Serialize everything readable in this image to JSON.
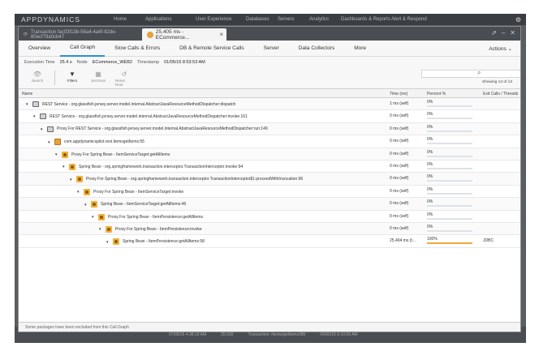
{
  "app": {
    "logo": "APPDYNAMICS",
    "nav": [
      "Home",
      "Applications",
      "User Experience",
      "Databases",
      "Servers",
      "Analytics",
      "Dashboards & Reports",
      "Alert & Respond"
    ],
    "footer": [
      "07/05/16 4:38:19 AM",
      "25,530",
      "Transaction: /items/getItems/98/",
      "06/05/16 6:10:59 AM"
    ]
  },
  "window": {
    "tab_inactive_label": "Transaction fac03f13b-56a4-4a6f-82de-80ecf79a0cb47",
    "tab_active_label": "25,405 ms - ECommerce...",
    "controls": [
      "⇗",
      "–",
      "✕"
    ]
  },
  "menu": {
    "items": [
      "Overview",
      "Call Graph",
      "Slow Calls & Errors",
      "DB & Remote Service Calls",
      "Server",
      "Data Collectors",
      "More"
    ],
    "active_index": 1,
    "actions_label": "Actions"
  },
  "info": {
    "exec_time_label": "Execution Time",
    "exec_time_value": "25.4 s",
    "node_label": "Node",
    "node_value": "ECommerce_WEB2",
    "timestamp_label": "Timestamp",
    "timestamp_value": "01/05/16 8:53:53 AM"
  },
  "toolbar": {
    "buttons": [
      {
        "label": "Search",
        "icon": "eye-icon",
        "enabled": false
      },
      {
        "label": "Filters",
        "icon": "filter-icon",
        "enabled": true
      },
      {
        "label": "Set Root",
        "icon": "set-root-icon",
        "enabled": false
      },
      {
        "label": "Reset Root",
        "icon": "reset-root-icon",
        "enabled": false
      }
    ],
    "search_placeholder": "",
    "showing_text": "Showing 13 of 13"
  },
  "table": {
    "columns": [
      "Name",
      "Time (ms)",
      "Percent %",
      "Exit Calls / Threads"
    ],
    "rows": [
      {
        "icon": "service",
        "depth": 0,
        "name": "REST Service - org.glassfish.jersey.server.model.internal.AbstractJavaResourceMethodDispatcher:dispatch",
        "time": "1 ms (self)",
        "percent": "0%",
        "fraction": 0,
        "exit": ""
      },
      {
        "icon": "service",
        "depth": 1,
        "name": "REST Service - org.glassfish.jersey.server.model.internal.AbstractJavaResourceMethodDispatcher:invoke:161",
        "time": "0 ms (self)",
        "percent": "0%",
        "fraction": 0,
        "exit": ""
      },
      {
        "icon": "service",
        "depth": 2,
        "name": "Proxy For REST Service - org.glassfish.jersey.server.model.internal.AbstractJavaResourceMethodDispatcher:run:149",
        "time": "0 ms (self)",
        "percent": "0%",
        "fraction": 0,
        "exit": ""
      },
      {
        "icon": "package",
        "depth": 3,
        "name": "com.appdynamicspilot.rest.ItemsgetItems:55",
        "time": "0 ms (self)",
        "percent": "0%",
        "fraction": 0,
        "exit": ""
      },
      {
        "icon": "bean",
        "depth": 4,
        "name": "Proxy For Spring Bean - ItemServiceTarget:getAllItems",
        "time": "0 ms (self)",
        "percent": "0%",
        "fraction": 0,
        "exit": ""
      },
      {
        "icon": "bean",
        "depth": 5,
        "name": "Spring Bean - org.springframework.transaction.interceptor.TransactionInterceptor:invoke:94",
        "time": "0 ms (self)",
        "percent": "0%",
        "fraction": 0,
        "exit": ""
      },
      {
        "icon": "bean",
        "depth": 6,
        "name": "Proxy For Spring Bean - org.springframework.transaction.interceptor.TransactionInterceptor$1:proceedWithInvocation:96",
        "time": "0 ms (self)",
        "percent": "0%",
        "fraction": 0,
        "exit": ""
      },
      {
        "icon": "bean",
        "depth": 7,
        "name": "Proxy For Spring Bean - ItemServiceTarget:invoke",
        "time": "0 ms (self)",
        "percent": "0%",
        "fraction": 0,
        "exit": ""
      },
      {
        "icon": "bean",
        "depth": 8,
        "name": "Spring Bean - ItemServiceTarget:getAllItems:46",
        "time": "0 ms (self)",
        "percent": "0%",
        "fraction": 0,
        "exit": ""
      },
      {
        "icon": "bean",
        "depth": 9,
        "name": "Proxy For Spring Bean - ItemPersistence:getAllItems",
        "time": "0 ms (self)",
        "percent": "0%",
        "fraction": 0,
        "exit": ""
      },
      {
        "icon": "bean",
        "depth": 10,
        "name": "Proxy For Spring Bean - ItemPersistence:invoke",
        "time": "0 ms (self)",
        "percent": "0%",
        "fraction": 0,
        "exit": ""
      },
      {
        "icon": "bean",
        "depth": 11,
        "name": "Spring Bean - ItemPersistence:getAllItems:58",
        "time": "25,404 ms (t...",
        "percent": "100%",
        "fraction": 1,
        "exit": "JDBC"
      }
    ]
  },
  "status": {
    "message": "Some packages have been excluded from this Call Graph"
  },
  "colors": {
    "accent": "#2a8fd6",
    "bar_fill": "#f0a93a",
    "bar_track": "#dde3ea",
    "titlebar": "#4a4d52"
  }
}
